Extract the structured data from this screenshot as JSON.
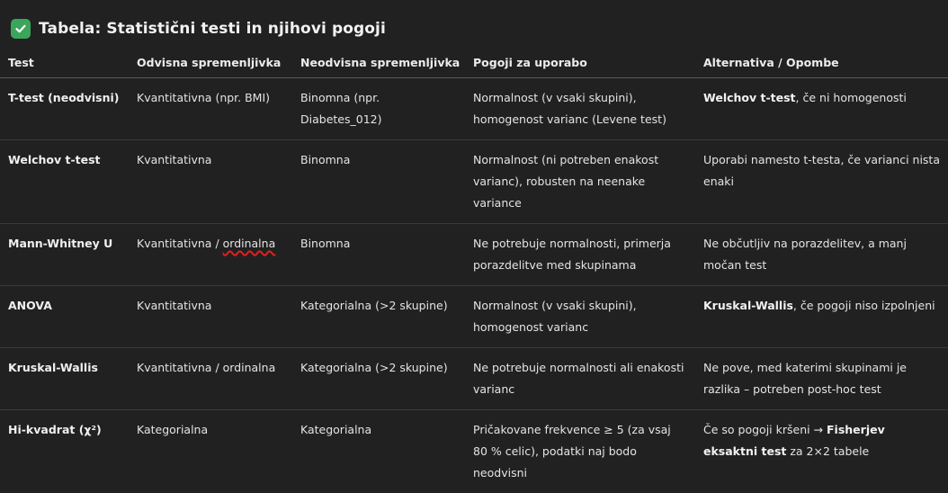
{
  "heading": {
    "icon": "check-mark-icon",
    "title": "Tabela: Statistični testi in njihovi pogoji"
  },
  "table": {
    "headers": [
      "Test",
      "Odvisna spremenljivka",
      "Neodvisna spremenljivka",
      "Pogoji za uporabo",
      "Alternativa / Opombe"
    ],
    "rows": [
      {
        "test": "T-test (neodvisni)",
        "dependent": "Kvantitativna (npr. BMI)",
        "independent": "Binomna (npr. Diabetes_012)",
        "conditions": "Normalnost (v vsaki skupini), homogenost varianc (Levene test)",
        "alt_bold": "Welchov t-test",
        "alt_rest": ", če ni homogenosti"
      },
      {
        "test": "Welchov t-test",
        "dependent": "Kvantitativna",
        "independent": "Binomna",
        "conditions": "Normalnost (ni potreben enakost varianc), robusten na neenake variance",
        "alt_text": "Uporabi namesto t-testa, če varianci nista enaki"
      },
      {
        "test": "Mann-Whitney U",
        "dependent_main": "Kvantitativna / ",
        "dependent_marked": "ordinalna",
        "independent": "Binomna",
        "conditions": "Ne potrebuje normalnosti, primerja porazdelitve med skupinama",
        "alt_text": "Ne občutljiv na porazdelitev, a manj močan test"
      },
      {
        "test": "ANOVA",
        "dependent": "Kvantitativna",
        "independent": "Kategorialna (>2 skupine)",
        "conditions": "Normalnost (v vsaki skupini), homogenost varianc",
        "alt_bold": "Kruskal-Wallis",
        "alt_rest": ", če pogoji niso izpolnjeni"
      },
      {
        "test": "Kruskal-Wallis",
        "dependent": "Kvantitativna / ordinalna",
        "independent": "Kategorialna (>2 skupine)",
        "conditions": "Ne potrebuje normalnosti ali enakosti varianc",
        "alt_text": "Ne pove, med katerimi skupinami je razlika – potreben post-hoc test"
      },
      {
        "test": "Hi-kvadrat (χ²)",
        "dependent": "Kategorialna",
        "independent": "Kategorialna",
        "conditions": "Pričakovane frekvence ≥ 5 (za vsaj 80 % celic), podatki naj bodo neodvisni",
        "alt_pre": "Če so pogoji kršeni → ",
        "alt_bold": "Fisherjev eksaktni test",
        "alt_rest": " za 2×2 tabele"
      }
    ]
  },
  "colors": {
    "background": "#212121",
    "text": "#ececec",
    "check_icon": "#3ba55c",
    "spellcheck_underline": "#e02020"
  }
}
